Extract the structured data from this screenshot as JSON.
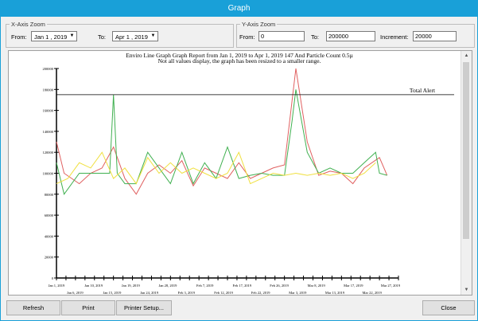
{
  "window": {
    "title": "Graph"
  },
  "x_zoom": {
    "legend": "X-Axis Zoom",
    "from_label": "From:",
    "from_value": "Jan  1 , 2019",
    "to_label": "To:",
    "to_value": "Apr  1 , 2019"
  },
  "y_zoom": {
    "legend": "Y-Axis Zoom",
    "from_label": "From:",
    "from_value": "0",
    "to_label": "To:",
    "to_value": "200000",
    "inc_label": "Increment:",
    "inc_value": "20000"
  },
  "buttons": {
    "refresh": "Refresh",
    "print": "Print",
    "printer_setup": "Printer Setup...",
    "close": "Close"
  },
  "colors": {
    "title_bar": "#19a0d8",
    "red": "#e06060",
    "green": "#40b050",
    "yellow": "#f0e040"
  },
  "chart_data": {
    "type": "line",
    "title": "Enviro Line Graph Graph Report from Jan 1, 2019 to Apr 1, 2019 147 And Particle Count 0.5µ",
    "subtitle": "Not all values display, the graph has been resized to a smaller range.",
    "ylim": [
      0,
      200000
    ],
    "yticks": [
      "0",
      "20000",
      "40000",
      "60000",
      "80000",
      "100000",
      "120000",
      "140000",
      "160000",
      "180000",
      "200000"
    ],
    "xlim": [
      "2019-01-01",
      "2019-04-01"
    ],
    "xticks_top": [
      "Jan 1, 2019",
      "Jan 10, 2019",
      "Jan 19, 2019",
      "Jan 28, 2019",
      "Feb 7, 2019",
      "Feb 17, 2019",
      "Feb 26, 2019",
      "Mar 8, 2019",
      "Mar 17, 2019",
      "Mar 27, 2019"
    ],
    "xticks_bottom": [
      "Jan 6, 2019",
      "Jan 15, 2019",
      "Jan 24, 2019",
      "Feb 3, 2019",
      "Feb 12, 2019",
      "Feb 22, 2019",
      "Mar 3, 2019",
      "Mar 13, 2019",
      "Mar 22, 2019"
    ],
    "threshold": {
      "label": "Total Alert",
      "value": 175000
    },
    "series": [
      {
        "color": "#e06060",
        "x": [
          "2019-01-01",
          "2019-01-03",
          "2019-01-07",
          "2019-01-10",
          "2019-01-13",
          "2019-01-16",
          "2019-01-19",
          "2019-01-22",
          "2019-01-25",
          "2019-01-28",
          "2019-01-31",
          "2019-02-03",
          "2019-02-06",
          "2019-02-09",
          "2019-02-12",
          "2019-02-15",
          "2019-02-18",
          "2019-02-21",
          "2019-02-24",
          "2019-02-27",
          "2019-03-02",
          "2019-03-05",
          "2019-03-08",
          "2019-03-11",
          "2019-03-14",
          "2019-03-17",
          "2019-03-20",
          "2019-03-23",
          "2019-03-27",
          "2019-03-29"
        ],
        "y": [
          130000,
          100000,
          90000,
          100000,
          105000,
          125000,
          95000,
          80000,
          100000,
          108000,
          100000,
          112000,
          88000,
          105000,
          100000,
          95000,
          110000,
          95000,
          100000,
          105000,
          108000,
          200000,
          130000,
          98000,
          102000,
          100000,
          90000,
          105000,
          115000,
          98000
        ]
      },
      {
        "color": "#40b050",
        "x": [
          "2019-01-01",
          "2019-01-03",
          "2019-01-07",
          "2019-01-10",
          "2019-01-13",
          "2019-01-15",
          "2019-01-16",
          "2019-01-17",
          "2019-01-19",
          "2019-01-22",
          "2019-01-25",
          "2019-01-28",
          "2019-01-31",
          "2019-02-03",
          "2019-02-06",
          "2019-02-09",
          "2019-02-12",
          "2019-02-15",
          "2019-02-18",
          "2019-02-21",
          "2019-02-24",
          "2019-02-27",
          "2019-03-02",
          "2019-03-04",
          "2019-03-05",
          "2019-03-08",
          "2019-03-11",
          "2019-03-14",
          "2019-03-17",
          "2019-03-20",
          "2019-03-23",
          "2019-03-26",
          "2019-03-27",
          "2019-03-29"
        ],
        "y": [
          110000,
          80000,
          100000,
          100000,
          100000,
          100000,
          175000,
          100000,
          90000,
          90000,
          120000,
          105000,
          90000,
          120000,
          90000,
          110000,
          95000,
          125000,
          95000,
          98000,
          100000,
          98000,
          98000,
          150000,
          180000,
          120000,
          100000,
          105000,
          100000,
          100000,
          110000,
          120000,
          100000,
          98000
        ]
      },
      {
        "color": "#f0e040",
        "x": [
          "2019-01-01",
          "2019-01-04",
          "2019-01-07",
          "2019-01-10",
          "2019-01-13",
          "2019-01-16",
          "2019-01-19",
          "2019-01-22",
          "2019-01-25",
          "2019-01-28",
          "2019-01-31",
          "2019-02-03",
          "2019-02-06",
          "2019-02-09",
          "2019-02-12",
          "2019-02-15",
          "2019-02-18",
          "2019-02-21",
          "2019-02-24",
          "2019-02-27",
          "2019-03-02",
          "2019-03-05",
          "2019-03-08",
          "2019-03-11",
          "2019-03-14",
          "2019-03-17",
          "2019-03-20",
          "2019-03-23",
          "2019-03-26"
        ],
        "y": [
          90000,
          95000,
          110000,
          105000,
          120000,
          95000,
          105000,
          90000,
          115000,
          100000,
          110000,
          100000,
          105000,
          100000,
          95000,
          100000,
          120000,
          90000,
          95000,
          100000,
          98000,
          100000,
          98000,
          100000,
          98000,
          100000,
          95000,
          100000,
          110000
        ]
      }
    ]
  }
}
